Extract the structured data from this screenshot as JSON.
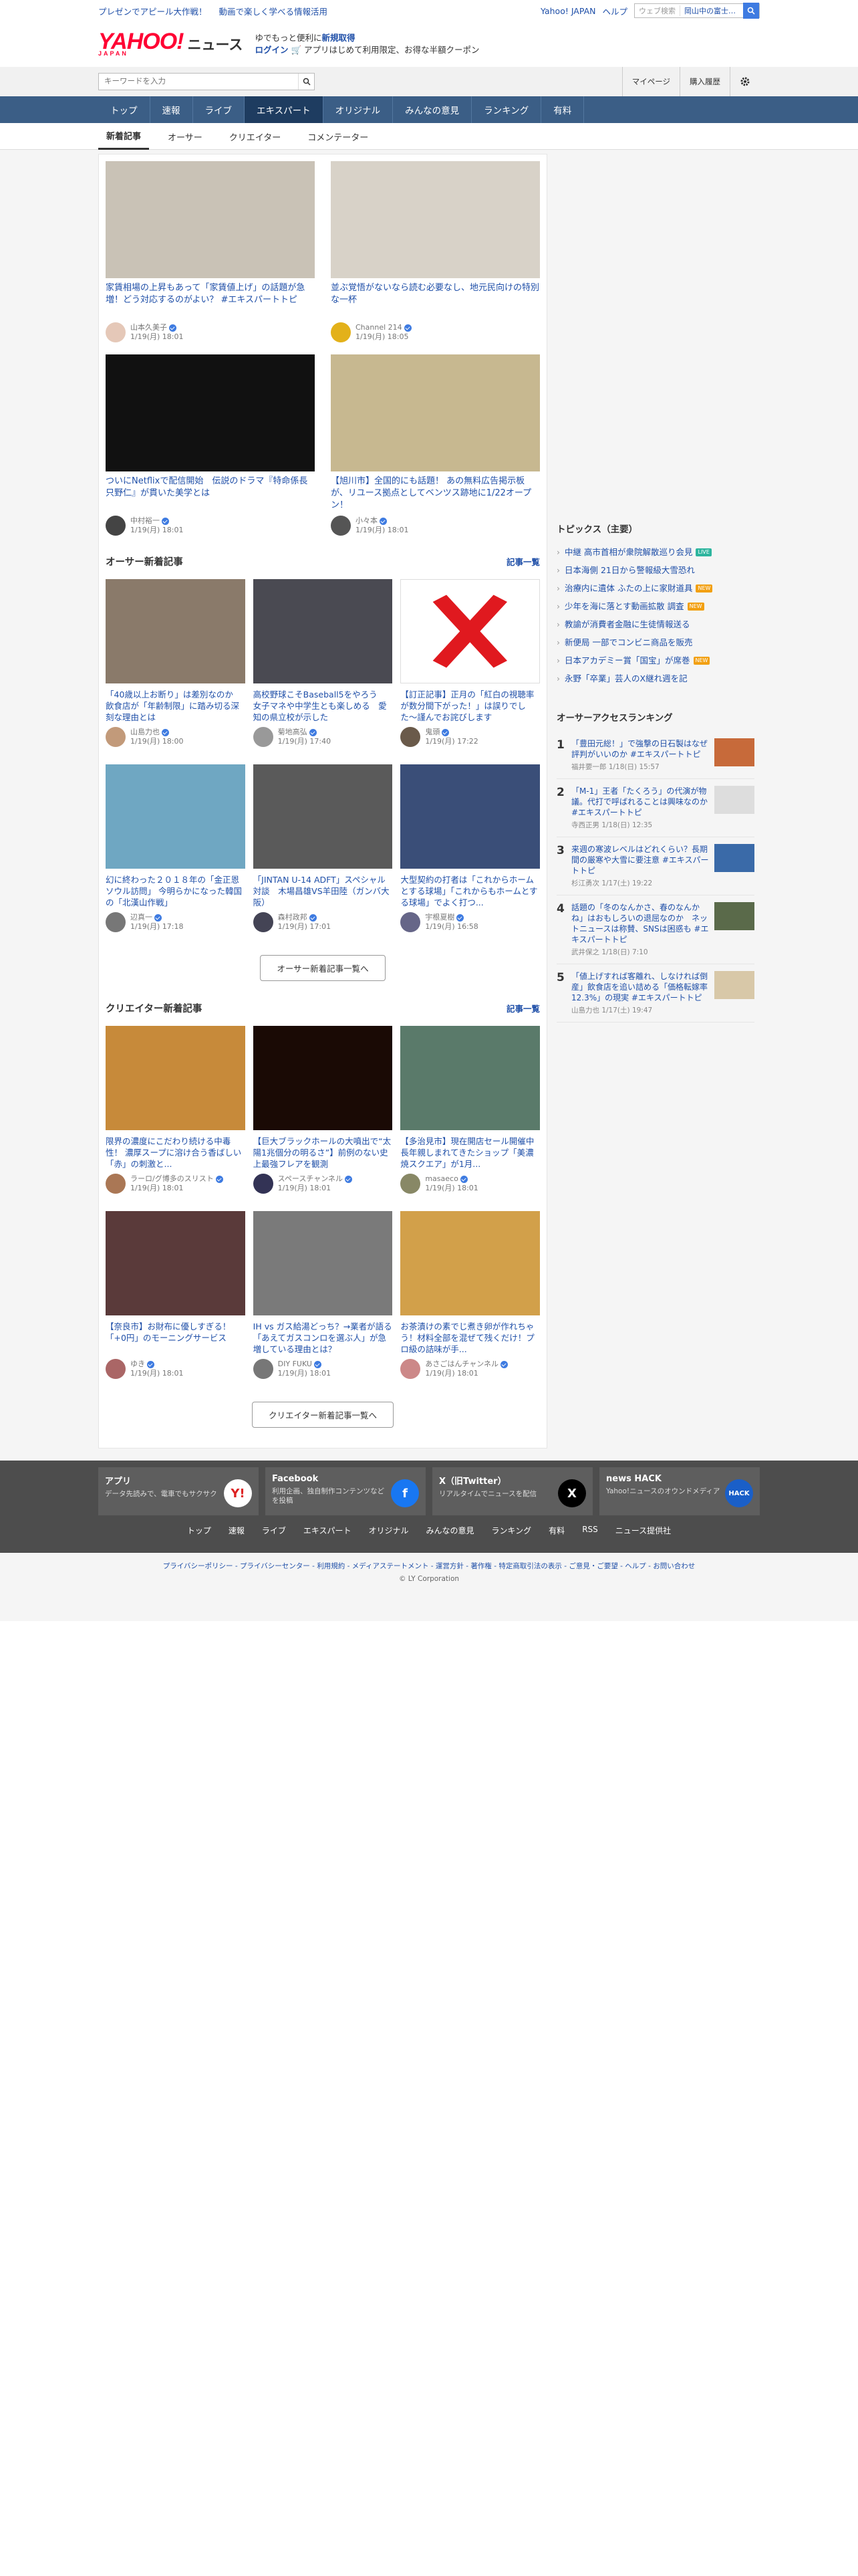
{
  "promo": {
    "link1": "プレゼンでアピール大作戦！",
    "link2": "動画で楽しく学べる情報活用"
  },
  "topbar": {
    "yahoo_japan": "Yahoo! JAPAN",
    "help": "ヘルプ",
    "search_placeholder": "ウェブ検索",
    "location": "岡山中の富士…"
  },
  "logo": {
    "yahoo": "YAHOO!",
    "japan": "JAPAN",
    "news": "ニュース"
  },
  "header_msg": {
    "line1_a": "ゆでもっと便利に",
    "line1_b": "新規取得",
    "login": "ログイン",
    "line2": "アプリはじめて利用限定、お得な半額クーポン"
  },
  "search": {
    "placeholder": "キーワードを入力",
    "mypage": "マイページ",
    "history": "購入履歴"
  },
  "nav": [
    "トップ",
    "速報",
    "ライブ",
    "エキスパート",
    "オリジナル",
    "みんなの意見",
    "ランキング",
    "有料"
  ],
  "subtabs": [
    "新着記事",
    "オーサー",
    "クリエイター",
    "コメンテーター"
  ],
  "top_articles": [
    {
      "title": "家賃相場の上昇もあって「家賃値上げ」の話題が急増！どう対応するのがよい？ #エキスパートトピ",
      "author": "山本久美子",
      "date": "1/19(月) 18:01",
      "color": "#c9c2b6",
      "av": "#e5c8b8"
    },
    {
      "title": "並ぶ覚悟がないなら読む必要なし、地元民向けの特別な一杯",
      "author": "Channel 214",
      "date": "1/19(月) 18:05",
      "color": "#d8d2c8",
      "av": "#e3b11a"
    },
    {
      "title": "ついにNetflixで配信開始　伝説のドラマ『特命係長 只野仁』が貫いた美学とは",
      "author": "中村裕一",
      "date": "1/19(月) 18:01",
      "color": "#111",
      "av": "#444"
    },
    {
      "title": "【旭川市】全国的にも話題！ あの無料広告掲示板が、リユース拠点としてベンツス跡地に1/22オープン！",
      "author": "小々本",
      "date": "1/19(月) 18:01",
      "color": "#c7b890",
      "av": "#555"
    }
  ],
  "author_section": {
    "title": "オーサー新着記事",
    "more": "記事一覧",
    "button": "オーサー新着記事一覧へ"
  },
  "author_articles": [
    {
      "title": "「40歳以上お断り」は差別なのか　飲食店が「年齢制限」に踏み切る深刻な理由とは",
      "author": "山島力也",
      "date": "1/19(月) 18:00",
      "color": "#8a7a6a",
      "av": "#c29a7a"
    },
    {
      "title": "高校野球こそBaseball5をやろう　女子マネや中学生とも楽しめる　愛知の県立校が示した",
      "author": "菊地高弘",
      "date": "1/19(月) 17:40",
      "color": "#4a4a52",
      "av": "#999"
    },
    {
      "title": "【訂正記事】正月の「紅白の視聴率が数分間下がった！」は誤りでした〜謹んでお詫びします",
      "author": "鬼頭",
      "date": "1/19(月) 17:22",
      "color": "#fff",
      "av": "#6a5a4a"
    },
    {
      "title": "幻に終わった２０１８年の「金正恩ソウル訪問」 今明らかになった韓国の「北漢山作戦」",
      "author": "辺真一",
      "date": "1/19(月) 17:18",
      "color": "#6fa7c2",
      "av": "#777"
    },
    {
      "title": "「JINTAN U-14 ADFT」スペシャル対談　木場昌雄VS羊田陸（ガンバ大阪）",
      "author": "森村政邦",
      "date": "1/19(月) 17:01",
      "color": "#5a5a5a",
      "av": "#445"
    },
    {
      "title": "大型契約の打者は「これからホームとする球場」「これからもホームとする球場」でよく打つ...",
      "author": "宇根夏樹",
      "date": "1/19(月) 16:58",
      "color": "#3a4e78",
      "av": "#668"
    }
  ],
  "creator_section": {
    "title": "クリエイター新着記事",
    "more": "記事一覧",
    "button": "クリエイター新着記事一覧へ"
  },
  "creator_articles": [
    {
      "title": "限界の濃度にこだわり続ける中毒性！ 濃厚スープに溶け合う香ばしい「赤」の刺激と...",
      "author": "ラーロ/グ博多のスリスト",
      "date": "1/19(月) 18:01",
      "color": "#c78a3a",
      "av": "#aa7755"
    },
    {
      "title": "【巨大ブラックホールの大噴出で“太陽1兆個分の明るさ”】前例のない史上最強フレアを観測",
      "author": "スペースチャンネル",
      "date": "1/19(月) 18:01",
      "color": "#1a0a05",
      "av": "#335"
    },
    {
      "title": "【多治見市】現在開店セール開催中　長年親しまれてきたショップ「美濃焼スクエア」が1月...",
      "author": "masaeco",
      "date": "1/19(月) 18:01",
      "color": "#5a7a6a",
      "av": "#886"
    },
    {
      "title": "【奈良市】お財布に優しすぎる！「+0円」のモーニングサービス",
      "author": "ゆき",
      "date": "1/19(月) 18:01",
      "color": "#5a3a3a",
      "av": "#a66"
    },
    {
      "title": "IH vs ガス給湯どっち？→業者が語る「あえてガスコンロを選ぶ人」が急増している理由とは？",
      "author": "DIY FUKU",
      "date": "1/19(月) 18:01",
      "color": "#7a7a7a",
      "av": "#777"
    },
    {
      "title": "お茶漬けの素でじ煮き卵が作れちゃう！材料全部を混ぜて残くだけ！プロ級の詰味が手...",
      "author": "あさごはんチャンネル",
      "date": "1/19(月) 18:01",
      "color": "#d2a04a",
      "av": "#c88"
    }
  ],
  "topics": {
    "title": "トピックス（主要）",
    "items": [
      {
        "text": "中継 高市首相が衆院解散巡り会見",
        "badge": "LIVE",
        "color": "#2db59e"
      },
      {
        "text": "日本海側 21日から警報級大雪恐れ",
        "badge": "",
        "color": ""
      },
      {
        "text": "治療内に遺体 ふたの上に家財道具",
        "badge": "NEW",
        "color": "#f2a012"
      },
      {
        "text": "少年を海に落とす動画拡散 調査",
        "badge": "NEW",
        "color": "#f2a012"
      },
      {
        "text": "教諭が消費者金融に生徒情報送る",
        "badge": "",
        "color": ""
      },
      {
        "text": "新便局 一部でコンビニ商品を販売",
        "badge": "",
        "color": ""
      },
      {
        "text": "日本アカデミー賞「国宝」が席巻",
        "badge": "NEW",
        "color": "#f2a012"
      },
      {
        "text": "永野「卒業」芸人のX継れ週を記",
        "badge": "",
        "color": ""
      }
    ]
  },
  "ranking": {
    "title": "オーサーアクセスランキング",
    "items": [
      {
        "n": "1",
        "title": "「豊田元総！」で強撃の日石製はなぜ評判がいいのか #エキスパートトピ",
        "meta": "福井要一郎 1/18(日) 15:57",
        "color": "#c76a3a"
      },
      {
        "n": "2",
        "title": "「M-1」王者「たくろう」の代演が物議。代打で呼ばれることは興味なのか #エキスパートトピ",
        "meta": "寺西正男 1/18(日) 12:35",
        "color": "#ddd"
      },
      {
        "n": "3",
        "title": "来週の寒波レベルはどれくらい？長期間の厳寒や大雪に要注意 #エキスパートトピ",
        "meta": "杉江勇次 1/17(土) 19:22",
        "color": "#3a6aa8"
      },
      {
        "n": "4",
        "title": "話題の「冬のなんかさ、春のなんかね」はおもしろいの退屈なのか　ネットニュースは称賛、SNSは困惑も #エキスパートトピ",
        "meta": "武井保之 1/18(日) 7:10",
        "color": "#5a6a4a"
      },
      {
        "n": "5",
        "title": "「値上げすれば客離れ、しなければ倒産」飲食店を追い詰める「価格転嫁率12.3%」の現実 #エキスパートトピ",
        "meta": "山島力也 1/17(土) 19:47",
        "color": "#d8c8a8"
      }
    ]
  },
  "footer": {
    "cards": [
      {
        "title": "アプリ",
        "desc": "データ先読みで、電車でもサクサク",
        "icon": "news-app-icon"
      },
      {
        "title": "Facebook",
        "desc": "利用企画、独自制作コンテンツなどを投稿",
        "icon": "facebook-icon"
      },
      {
        "title": "X（旧Twitter）",
        "desc": "リアルタイムでニュースを配信",
        "icon": "x-icon"
      },
      {
        "title": "news HACK",
        "desc": "Yahoo!ニュースのオウンドメディア",
        "icon": "news-hack-icon"
      }
    ],
    "links": [
      "トップ",
      "速報",
      "ライブ",
      "エキスパート",
      "オリジナル",
      "みんなの意見",
      "ランキング",
      "有料",
      "RSS",
      "ニュース提供社"
    ],
    "legal": "プライバシーポリシー - プライバシーセンター - 利用規約 - メディアステートメント - 運営方針 - 著作権 - 特定商取引法の表示 - ご意見・ご要望 - ヘルプ - お問い合わせ",
    "copyright": "© LY Corporation"
  }
}
